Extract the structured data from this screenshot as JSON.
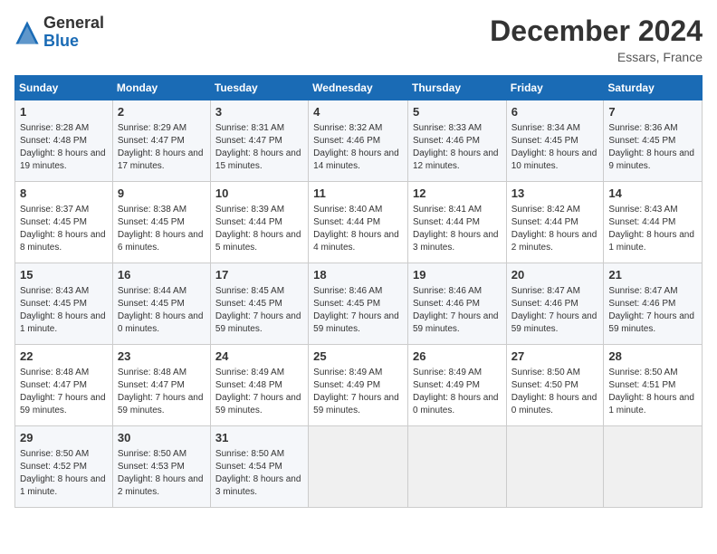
{
  "logo": {
    "general": "General",
    "blue": "Blue"
  },
  "title": "December 2024",
  "location": "Essars, France",
  "days_of_week": [
    "Sunday",
    "Monday",
    "Tuesday",
    "Wednesday",
    "Thursday",
    "Friday",
    "Saturday"
  ],
  "weeks": [
    [
      {
        "day": "1",
        "sunrise": "Sunrise: 8:28 AM",
        "sunset": "Sunset: 4:48 PM",
        "daylight": "Daylight: 8 hours and 19 minutes."
      },
      {
        "day": "2",
        "sunrise": "Sunrise: 8:29 AM",
        "sunset": "Sunset: 4:47 PM",
        "daylight": "Daylight: 8 hours and 17 minutes."
      },
      {
        "day": "3",
        "sunrise": "Sunrise: 8:31 AM",
        "sunset": "Sunset: 4:47 PM",
        "daylight": "Daylight: 8 hours and 15 minutes."
      },
      {
        "day": "4",
        "sunrise": "Sunrise: 8:32 AM",
        "sunset": "Sunset: 4:46 PM",
        "daylight": "Daylight: 8 hours and 14 minutes."
      },
      {
        "day": "5",
        "sunrise": "Sunrise: 8:33 AM",
        "sunset": "Sunset: 4:46 PM",
        "daylight": "Daylight: 8 hours and 12 minutes."
      },
      {
        "day": "6",
        "sunrise": "Sunrise: 8:34 AM",
        "sunset": "Sunset: 4:45 PM",
        "daylight": "Daylight: 8 hours and 10 minutes."
      },
      {
        "day": "7",
        "sunrise": "Sunrise: 8:36 AM",
        "sunset": "Sunset: 4:45 PM",
        "daylight": "Daylight: 8 hours and 9 minutes."
      }
    ],
    [
      {
        "day": "8",
        "sunrise": "Sunrise: 8:37 AM",
        "sunset": "Sunset: 4:45 PM",
        "daylight": "Daylight: 8 hours and 8 minutes."
      },
      {
        "day": "9",
        "sunrise": "Sunrise: 8:38 AM",
        "sunset": "Sunset: 4:45 PM",
        "daylight": "Daylight: 8 hours and 6 minutes."
      },
      {
        "day": "10",
        "sunrise": "Sunrise: 8:39 AM",
        "sunset": "Sunset: 4:44 PM",
        "daylight": "Daylight: 8 hours and 5 minutes."
      },
      {
        "day": "11",
        "sunrise": "Sunrise: 8:40 AM",
        "sunset": "Sunset: 4:44 PM",
        "daylight": "Daylight: 8 hours and 4 minutes."
      },
      {
        "day": "12",
        "sunrise": "Sunrise: 8:41 AM",
        "sunset": "Sunset: 4:44 PM",
        "daylight": "Daylight: 8 hours and 3 minutes."
      },
      {
        "day": "13",
        "sunrise": "Sunrise: 8:42 AM",
        "sunset": "Sunset: 4:44 PM",
        "daylight": "Daylight: 8 hours and 2 minutes."
      },
      {
        "day": "14",
        "sunrise": "Sunrise: 8:43 AM",
        "sunset": "Sunset: 4:44 PM",
        "daylight": "Daylight: 8 hours and 1 minute."
      }
    ],
    [
      {
        "day": "15",
        "sunrise": "Sunrise: 8:43 AM",
        "sunset": "Sunset: 4:45 PM",
        "daylight": "Daylight: 8 hours and 1 minute."
      },
      {
        "day": "16",
        "sunrise": "Sunrise: 8:44 AM",
        "sunset": "Sunset: 4:45 PM",
        "daylight": "Daylight: 8 hours and 0 minutes."
      },
      {
        "day": "17",
        "sunrise": "Sunrise: 8:45 AM",
        "sunset": "Sunset: 4:45 PM",
        "daylight": "Daylight: 7 hours and 59 minutes."
      },
      {
        "day": "18",
        "sunrise": "Sunrise: 8:46 AM",
        "sunset": "Sunset: 4:45 PM",
        "daylight": "Daylight: 7 hours and 59 minutes."
      },
      {
        "day": "19",
        "sunrise": "Sunrise: 8:46 AM",
        "sunset": "Sunset: 4:46 PM",
        "daylight": "Daylight: 7 hours and 59 minutes."
      },
      {
        "day": "20",
        "sunrise": "Sunrise: 8:47 AM",
        "sunset": "Sunset: 4:46 PM",
        "daylight": "Daylight: 7 hours and 59 minutes."
      },
      {
        "day": "21",
        "sunrise": "Sunrise: 8:47 AM",
        "sunset": "Sunset: 4:46 PM",
        "daylight": "Daylight: 7 hours and 59 minutes."
      }
    ],
    [
      {
        "day": "22",
        "sunrise": "Sunrise: 8:48 AM",
        "sunset": "Sunset: 4:47 PM",
        "daylight": "Daylight: 7 hours and 59 minutes."
      },
      {
        "day": "23",
        "sunrise": "Sunrise: 8:48 AM",
        "sunset": "Sunset: 4:47 PM",
        "daylight": "Daylight: 7 hours and 59 minutes."
      },
      {
        "day": "24",
        "sunrise": "Sunrise: 8:49 AM",
        "sunset": "Sunset: 4:48 PM",
        "daylight": "Daylight: 7 hours and 59 minutes."
      },
      {
        "day": "25",
        "sunrise": "Sunrise: 8:49 AM",
        "sunset": "Sunset: 4:49 PM",
        "daylight": "Daylight: 7 hours and 59 minutes."
      },
      {
        "day": "26",
        "sunrise": "Sunrise: 8:49 AM",
        "sunset": "Sunset: 4:49 PM",
        "daylight": "Daylight: 8 hours and 0 minutes."
      },
      {
        "day": "27",
        "sunrise": "Sunrise: 8:50 AM",
        "sunset": "Sunset: 4:50 PM",
        "daylight": "Daylight: 8 hours and 0 minutes."
      },
      {
        "day": "28",
        "sunrise": "Sunrise: 8:50 AM",
        "sunset": "Sunset: 4:51 PM",
        "daylight": "Daylight: 8 hours and 1 minute."
      }
    ],
    [
      {
        "day": "29",
        "sunrise": "Sunrise: 8:50 AM",
        "sunset": "Sunset: 4:52 PM",
        "daylight": "Daylight: 8 hours and 1 minute."
      },
      {
        "day": "30",
        "sunrise": "Sunrise: 8:50 AM",
        "sunset": "Sunset: 4:53 PM",
        "daylight": "Daylight: 8 hours and 2 minutes."
      },
      {
        "day": "31",
        "sunrise": "Sunrise: 8:50 AM",
        "sunset": "Sunset: 4:54 PM",
        "daylight": "Daylight: 8 hours and 3 minutes."
      },
      null,
      null,
      null,
      null
    ]
  ]
}
